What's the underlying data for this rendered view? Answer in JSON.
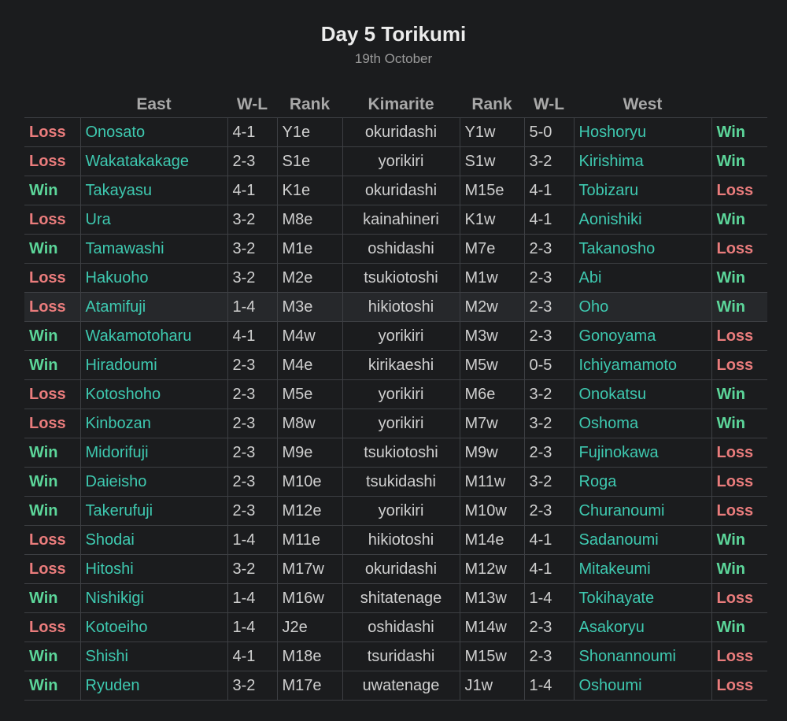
{
  "title": "Day 5 Torikumi",
  "subtitle": "19th October",
  "colors": {
    "win": "#5cd69a",
    "loss": "#ea7c7c",
    "name": "#3ec9b0",
    "background": "#1b1c1e"
  },
  "headers": {
    "east": "East",
    "east_wl": "W-L",
    "east_rank": "Rank",
    "kimarite": "Kimarite",
    "west_rank": "Rank",
    "west_wl": "W-L",
    "west": "West"
  },
  "bouts": [
    {
      "east_result": "Loss",
      "east_name": "Onosato",
      "east_wl": "4-1",
      "east_rank": "Y1e",
      "kimarite": "okuridashi",
      "west_rank": "Y1w",
      "west_wl": "5-0",
      "west_name": "Hoshoryu",
      "west_result": "Win"
    },
    {
      "east_result": "Loss",
      "east_name": "Wakatakakage",
      "east_wl": "2-3",
      "east_rank": "S1e",
      "kimarite": "yorikiri",
      "west_rank": "S1w",
      "west_wl": "3-2",
      "west_name": "Kirishima",
      "west_result": "Win"
    },
    {
      "east_result": "Win",
      "east_name": "Takayasu",
      "east_wl": "4-1",
      "east_rank": "K1e",
      "kimarite": "okuridashi",
      "west_rank": "M15e",
      "west_wl": "4-1",
      "west_name": "Tobizaru",
      "west_result": "Loss"
    },
    {
      "east_result": "Loss",
      "east_name": "Ura",
      "east_wl": "3-2",
      "east_rank": "M8e",
      "kimarite": "kainahineri",
      "west_rank": "K1w",
      "west_wl": "4-1",
      "west_name": "Aonishiki",
      "west_result": "Win"
    },
    {
      "east_result": "Win",
      "east_name": "Tamawashi",
      "east_wl": "3-2",
      "east_rank": "M1e",
      "kimarite": "oshidashi",
      "west_rank": "M7e",
      "west_wl": "2-3",
      "west_name": "Takanosho",
      "west_result": "Loss"
    },
    {
      "east_result": "Loss",
      "east_name": "Hakuoho",
      "east_wl": "3-2",
      "east_rank": "M2e",
      "kimarite": "tsukiotoshi",
      "west_rank": "M1w",
      "west_wl": "2-3",
      "west_name": "Abi",
      "west_result": "Win"
    },
    {
      "east_result": "Loss",
      "east_name": "Atamifuji",
      "east_wl": "1-4",
      "east_rank": "M3e",
      "kimarite": "hikiotoshi",
      "west_rank": "M2w",
      "west_wl": "2-3",
      "west_name": "Oho",
      "west_result": "Win"
    },
    {
      "east_result": "Win",
      "east_name": "Wakamotoharu",
      "east_wl": "4-1",
      "east_rank": "M4w",
      "kimarite": "yorikiri",
      "west_rank": "M3w",
      "west_wl": "2-3",
      "west_name": "Gonoyama",
      "west_result": "Loss"
    },
    {
      "east_result": "Win",
      "east_name": "Hiradoumi",
      "east_wl": "2-3",
      "east_rank": "M4e",
      "kimarite": "kirikaeshi",
      "west_rank": "M5w",
      "west_wl": "0-5",
      "west_name": "Ichiyamamoto",
      "west_result": "Loss"
    },
    {
      "east_result": "Loss",
      "east_name": "Kotoshoho",
      "east_wl": "2-3",
      "east_rank": "M5e",
      "kimarite": "yorikiri",
      "west_rank": "M6e",
      "west_wl": "3-2",
      "west_name": "Onokatsu",
      "west_result": "Win"
    },
    {
      "east_result": "Loss",
      "east_name": "Kinbozan",
      "east_wl": "2-3",
      "east_rank": "M8w",
      "kimarite": "yorikiri",
      "west_rank": "M7w",
      "west_wl": "3-2",
      "west_name": "Oshoma",
      "west_result": "Win"
    },
    {
      "east_result": "Win",
      "east_name": "Midorifuji",
      "east_wl": "2-3",
      "east_rank": "M9e",
      "kimarite": "tsukiotoshi",
      "west_rank": "M9w",
      "west_wl": "2-3",
      "west_name": "Fujinokawa",
      "west_result": "Loss"
    },
    {
      "east_result": "Win",
      "east_name": "Daieisho",
      "east_wl": "2-3",
      "east_rank": "M10e",
      "kimarite": "tsukidashi",
      "west_rank": "M11w",
      "west_wl": "3-2",
      "west_name": "Roga",
      "west_result": "Loss"
    },
    {
      "east_result": "Win",
      "east_name": "Takerufuji",
      "east_wl": "2-3",
      "east_rank": "M12e",
      "kimarite": "yorikiri",
      "west_rank": "M10w",
      "west_wl": "2-3",
      "west_name": "Churanoumi",
      "west_result": "Loss"
    },
    {
      "east_result": "Loss",
      "east_name": "Shodai",
      "east_wl": "1-4",
      "east_rank": "M11e",
      "kimarite": "hikiotoshi",
      "west_rank": "M14e",
      "west_wl": "4-1",
      "west_name": "Sadanoumi",
      "west_result": "Win"
    },
    {
      "east_result": "Loss",
      "east_name": "Hitoshi",
      "east_wl": "3-2",
      "east_rank": "M17w",
      "kimarite": "okuridashi",
      "west_rank": "M12w",
      "west_wl": "4-1",
      "west_name": "Mitakeumi",
      "west_result": "Win"
    },
    {
      "east_result": "Win",
      "east_name": "Nishikigi",
      "east_wl": "1-4",
      "east_rank": "M16w",
      "kimarite": "shitatenage",
      "west_rank": "M13w",
      "west_wl": "1-4",
      "west_name": "Tokihayate",
      "west_result": "Loss"
    },
    {
      "east_result": "Loss",
      "east_name": "Kotoeiho",
      "east_wl": "1-4",
      "east_rank": "J2e",
      "kimarite": "oshidashi",
      "west_rank": "M14w",
      "west_wl": "2-3",
      "west_name": "Asakoryu",
      "west_result": "Win"
    },
    {
      "east_result": "Win",
      "east_name": "Shishi",
      "east_wl": "4-1",
      "east_rank": "M18e",
      "kimarite": "tsuridashi",
      "west_rank": "M15w",
      "west_wl": "2-3",
      "west_name": "Shonannoumi",
      "west_result": "Loss"
    },
    {
      "east_result": "Win",
      "east_name": "Ryuden",
      "east_wl": "3-2",
      "east_rank": "M17e",
      "kimarite": "uwatenage",
      "west_rank": "J1w",
      "west_wl": "1-4",
      "west_name": "Oshoumi",
      "west_result": "Loss"
    }
  ]
}
